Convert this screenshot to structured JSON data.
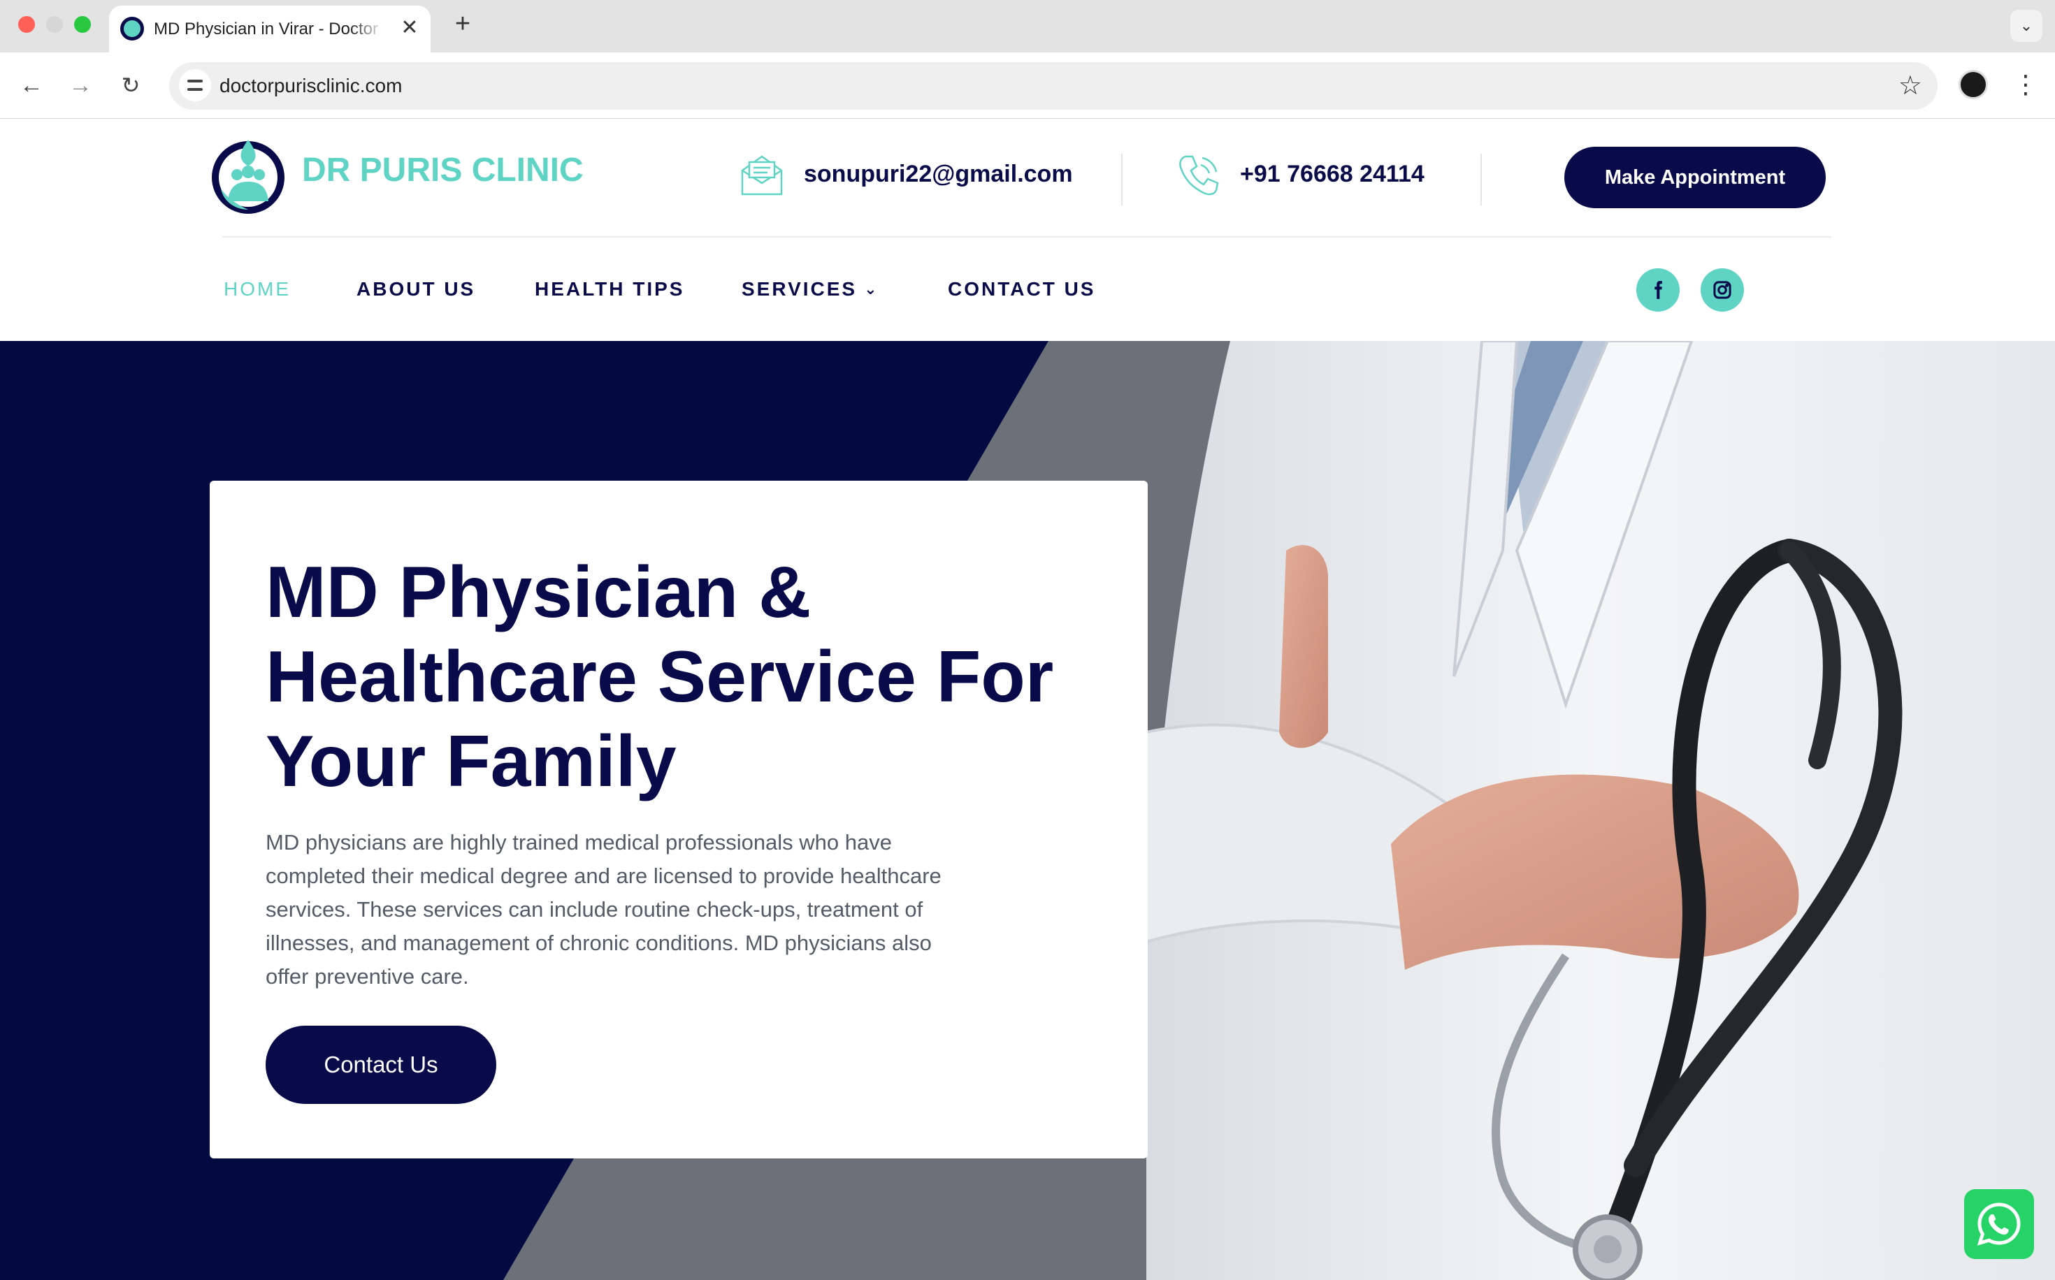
{
  "browser": {
    "tab_title": "MD Physician in Virar - Doctor Puris Clinic",
    "url": "doctorpurisclinic.com"
  },
  "header": {
    "logo_text": "DR PURIS CLINIC",
    "email": "sonupuri22@gmail.com",
    "phone": "+91 76668 24114",
    "appointment_label": "Make Appointment"
  },
  "nav": {
    "items": [
      {
        "label": "HOME",
        "active": true
      },
      {
        "label": "ABOUT US"
      },
      {
        "label": "HEALTH TIPS"
      },
      {
        "label": "SERVICES",
        "has_dropdown": true
      },
      {
        "label": "CONTACT US"
      }
    ],
    "social": [
      "facebook-icon",
      "instagram-icon"
    ]
  },
  "hero": {
    "title_line1": "MD Physician &",
    "title_highlight": "Healthcare",
    "title_line2_rest": " Service For",
    "title_line3": "Your Family",
    "description": "MD physicians are highly trained medical professionals who have completed their medical degree and are licensed to provide healthcare services. These services can include routine check-ups, treatment of illnesses, and management of chronic conditions. MD physicians also offer preventive care.",
    "cta_label": "Contact Us"
  },
  "colors": {
    "navy": "#080a4a",
    "teal": "#5fd4c4",
    "whatsapp": "#25d366"
  }
}
